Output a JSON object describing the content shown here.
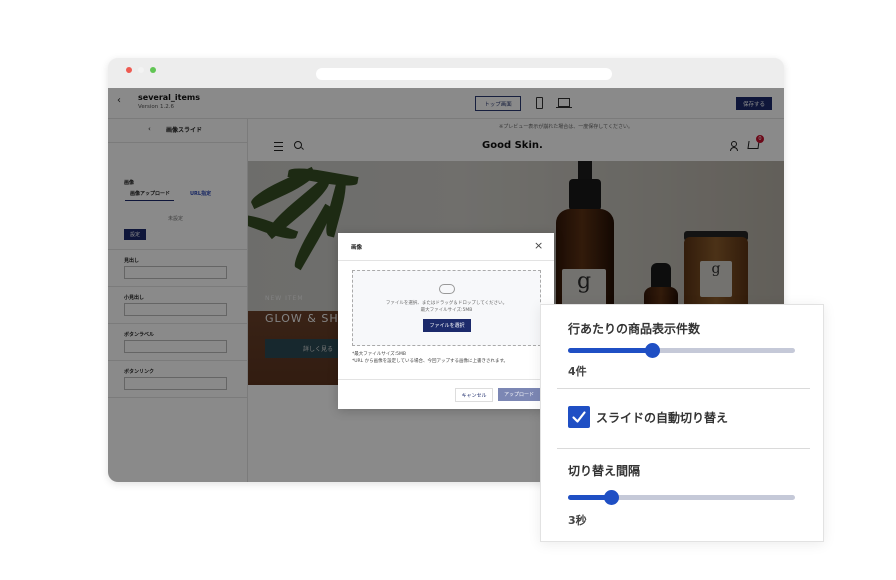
{
  "app": {
    "title": "several_items",
    "version": "Version 1.2.6",
    "top_page_button": "トップ画面",
    "save_button": "保存する",
    "preview_note": "※プレビュー表示が崩れた場合は、一度保存してください。"
  },
  "sidebar": {
    "title": "画像スライド",
    "image_label": "画像",
    "tab_upload": "画像アップロード",
    "tab_url": "URL指定",
    "unset": "未設定",
    "set_button": "設定",
    "heading_label": "見出し",
    "subheading_label": "小見出し",
    "button_label_label": "ボタンラベル",
    "button_link_label": "ボタンリンク"
  },
  "store": {
    "brand": "Good Skin.",
    "cart_count": "0",
    "hero_subtitle": "NEW ITEM",
    "hero_title": "GLOW & SHIN",
    "hero_button": "詳しく見る",
    "product_letter": "g"
  },
  "modal": {
    "title": "画像",
    "close": "×",
    "drop_text": "ファイルを選択、またはドラッグ＆ドロップしてください。",
    "drop_size": "最大ファイルサイズ:5MB",
    "select_button": "ファイルを選択",
    "note1": "*最大ファイルサイズ:5MB",
    "note2": "*URL から画像を設定している場合、今回アップする画像に上書きされます。",
    "cancel": "キャンセル",
    "upload": "アップロード"
  },
  "settings": {
    "items_per_row": {
      "label": "行あたりの商品表示件数",
      "value_text": "4件",
      "fraction": 0.37
    },
    "auto_slide": {
      "label": "スライドの自動切り替え",
      "checked": true
    },
    "interval": {
      "label": "切り替え間隔",
      "value_text": "3秒",
      "fraction": 0.19
    },
    "accent_color": "#1f4fc4"
  }
}
